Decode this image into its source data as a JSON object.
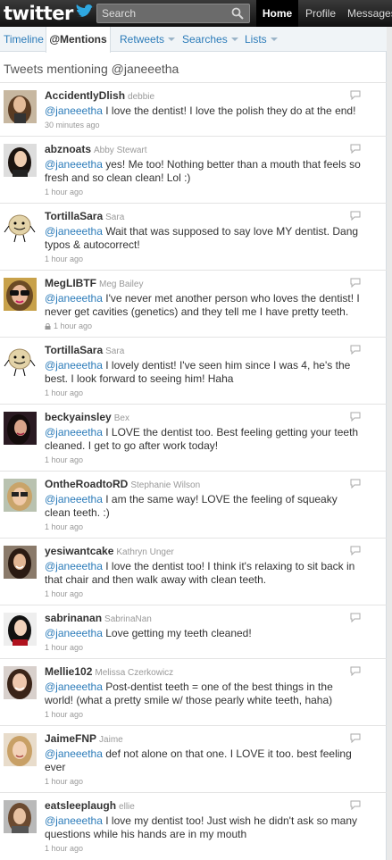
{
  "topbar": {
    "logo_text": "twitter",
    "search_placeholder": "Search",
    "nav": [
      "Home",
      "Profile",
      "Messages"
    ]
  },
  "tabs": [
    {
      "label": "Timeline",
      "has_caret": false
    },
    {
      "label": "@Mentions",
      "has_caret": false
    },
    {
      "label": "Retweets",
      "has_caret": true
    },
    {
      "label": "Searches",
      "has_caret": true
    },
    {
      "label": "Lists",
      "has_caret": true
    }
  ],
  "main": {
    "heading": "Tweets mentioning @janeeetha"
  },
  "tweets": [
    {
      "screen_name": "AccidentlyDlish",
      "full_name": "debbie",
      "mention": "@janeeetha",
      "text": " I love the dentist! I love the polish they do at the end!",
      "time": "30 minutes ago",
      "protected": false,
      "avatar": "brown-hair-woman"
    },
    {
      "screen_name": "abznoats",
      "full_name": "Abby Stewart",
      "mention": "@janeeetha",
      "text": " yes! Me too! Nothing better than a mouth that feels so fresh and so clean clean! Lol :)",
      "time": "1 hour ago",
      "protected": false,
      "avatar": "dark-hair-woman"
    },
    {
      "screen_name": "TortillaSara",
      "full_name": "Sara",
      "mention": "@janeeetha",
      "text": " Wait that was supposed to say love MY dentist. Dang typos & autocorrect!",
      "time": "1 hour ago",
      "protected": false,
      "avatar": "tortilla-cartoon"
    },
    {
      "screen_name": "MegLIBTF",
      "full_name": "Meg Bailey",
      "mention": "@janeeetha",
      "text": " I've never met another person who loves the dentist! I never get cavities (genetics) and they tell me I have pretty teeth.",
      "time": "1 hour ago",
      "protected": true,
      "avatar": "sunglasses-woman"
    },
    {
      "screen_name": "TortillaSara",
      "full_name": "Sara",
      "mention": "@janeeetha",
      "text": " I lovely dentist! I've seen him since I was 4, he's the best. I look forward to seeing him! Haha",
      "time": "1 hour ago",
      "protected": false,
      "avatar": "tortilla-cartoon"
    },
    {
      "screen_name": "beckyainsley",
      "full_name": "Bex",
      "mention": "@janeeetha",
      "text": " I LOVE the dentist too. Best feeling getting your teeth cleaned. I get to go after work today!",
      "time": "1 hour ago",
      "protected": false,
      "avatar": "dark-hair-woman-2"
    },
    {
      "screen_name": "OntheRoadtoRD",
      "full_name": "Stephanie Wilson",
      "mention": "@janeeetha",
      "text": " I am the same way! LOVE the feeling of squeaky clean teeth. :)",
      "time": "1 hour ago",
      "protected": false,
      "avatar": "blonde-woman-sunglasses"
    },
    {
      "screen_name": "yesiwantcake",
      "full_name": "Kathryn Unger",
      "mention": "@janeeetha",
      "text": " I love the dentist too! I think it's relaxing to sit back in that chair and then walk away with clean teeth.",
      "time": "1 hour ago",
      "protected": false,
      "avatar": "dark-hair-woman-3"
    },
    {
      "screen_name": "sabrinanan",
      "full_name": "SabrinaNan",
      "mention": "@janeeetha",
      "text": " Love getting my teeth cleaned!",
      "time": "1 hour ago",
      "protected": false,
      "avatar": "black-hair-woman"
    },
    {
      "screen_name": "Mellie102",
      "full_name": "Melissa Czerkowicz",
      "mention": "@janeeetha",
      "text": " Post-dentist teeth = one of the best things in the world! (what a pretty smile w/ those pearly white teeth, haha)",
      "time": "1 hour ago",
      "protected": false,
      "avatar": "brunette-woman"
    },
    {
      "screen_name": "JaimeFNP",
      "full_name": "Jaime",
      "mention": "@janeeetha",
      "text": " def not alone on that one. I LOVE it too. best feeling ever",
      "time": "1 hour ago",
      "protected": false,
      "avatar": "blonde-woman"
    },
    {
      "screen_name": "eatsleeplaugh",
      "full_name": "ellie",
      "mention": "@janeeetha",
      "text": " I love my dentist too! Just wish he didn't ask so many questions while his hands are in my mouth",
      "time": "1 hour ago",
      "protected": false,
      "avatar": "brown-hair-woman-2"
    }
  ]
}
